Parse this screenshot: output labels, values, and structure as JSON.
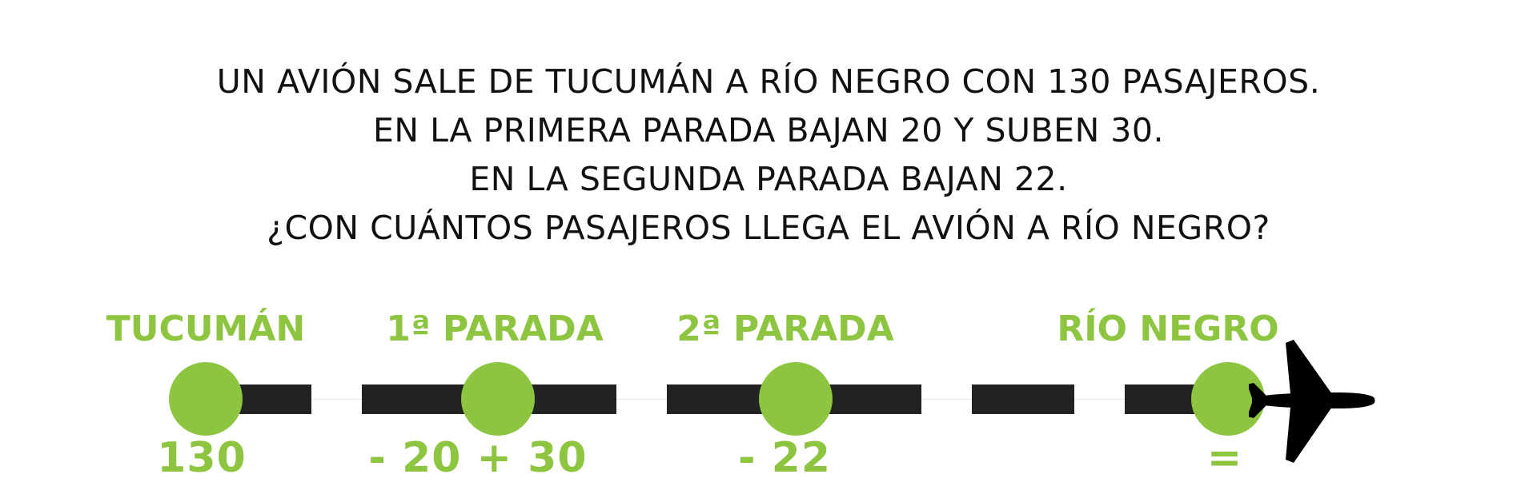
{
  "problem": {
    "lines": [
      "UN AVIÓN SALE DE TUCUMÁN A RÍO NEGRO CON 130 PASAJEROS.",
      "EN LA PRIMERA PARADA BAJAN 20 Y SUBEN 30.",
      "EN LA SEGUNDA PARADA BAJAN 22.",
      "¿CON CUÁNTOS PASAJEROS LLEGA EL AVIÓN A RÍO NEGRO?"
    ]
  },
  "stops": [
    {
      "label": "TUCUMÁN",
      "value": "130"
    },
    {
      "label": "1ª PARADA",
      "value": "- 20 + 30"
    },
    {
      "label": "2ª PARADA",
      "value": "- 22"
    },
    {
      "label": "RÍO NEGRO",
      "value": "="
    }
  ],
  "colors": {
    "accent": "#8dc540",
    "line": "#222222",
    "text": "#111111"
  },
  "icons": {
    "destination": "airplane-icon"
  }
}
